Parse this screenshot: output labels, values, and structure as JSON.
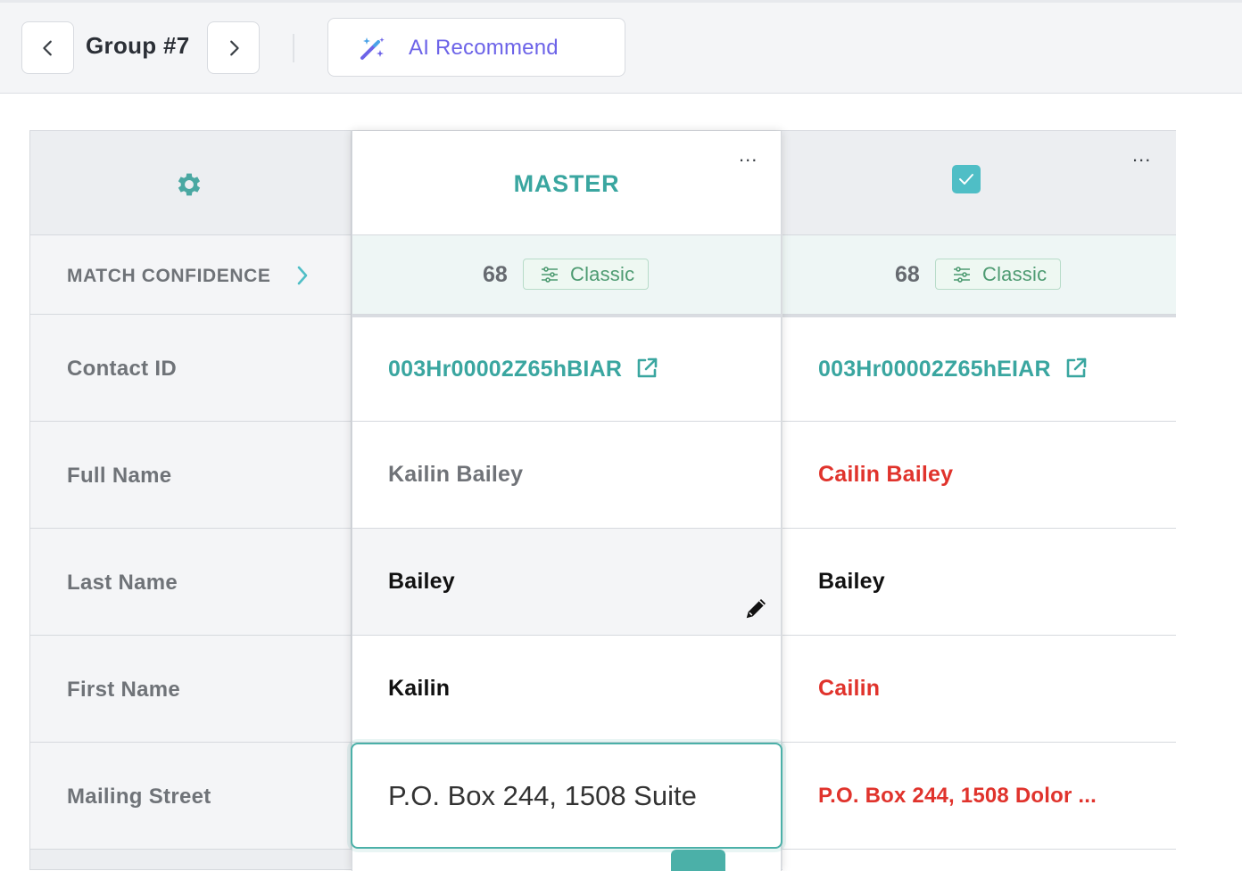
{
  "toolbar": {
    "group_title": "Group #7",
    "ai_recommend_label": "AI Recommend",
    "prev_icon": "chevron-left-icon",
    "next_icon": "chevron-right-icon",
    "ai_icon": "magic-wand-icon"
  },
  "labels": {
    "match_confidence": "MATCH CONFIDENCE",
    "contact_id": "Contact ID",
    "full_name": "Full Name",
    "last_name": "Last Name",
    "first_name": "First Name",
    "mailing_street": "Mailing Street"
  },
  "master": {
    "title": "MASTER",
    "menu": "...",
    "score": "68",
    "badge": "Classic",
    "contact_id": "003Hr00002Z65hBIAR",
    "full_name": "Kailin Bailey",
    "last_name": "Bailey",
    "first_name": "Kailin",
    "mailing_street": "P.O. Box 244, 1508 Suite"
  },
  "record": {
    "menu": "...",
    "checked": true,
    "score": "68",
    "badge": "Classic",
    "contact_id": "003Hr00002Z65hEIAR",
    "full_name": "Cailin Bailey",
    "last_name": "Bailey",
    "first_name": "Cailin",
    "mailing_street": "P.O. Box 244, 1508 Dolor ..."
  },
  "colors": {
    "accent": "#3aa6a0",
    "ai_purple": "#6c63e8",
    "diff_red": "#e0332c",
    "checkbox": "#4fbec6"
  }
}
